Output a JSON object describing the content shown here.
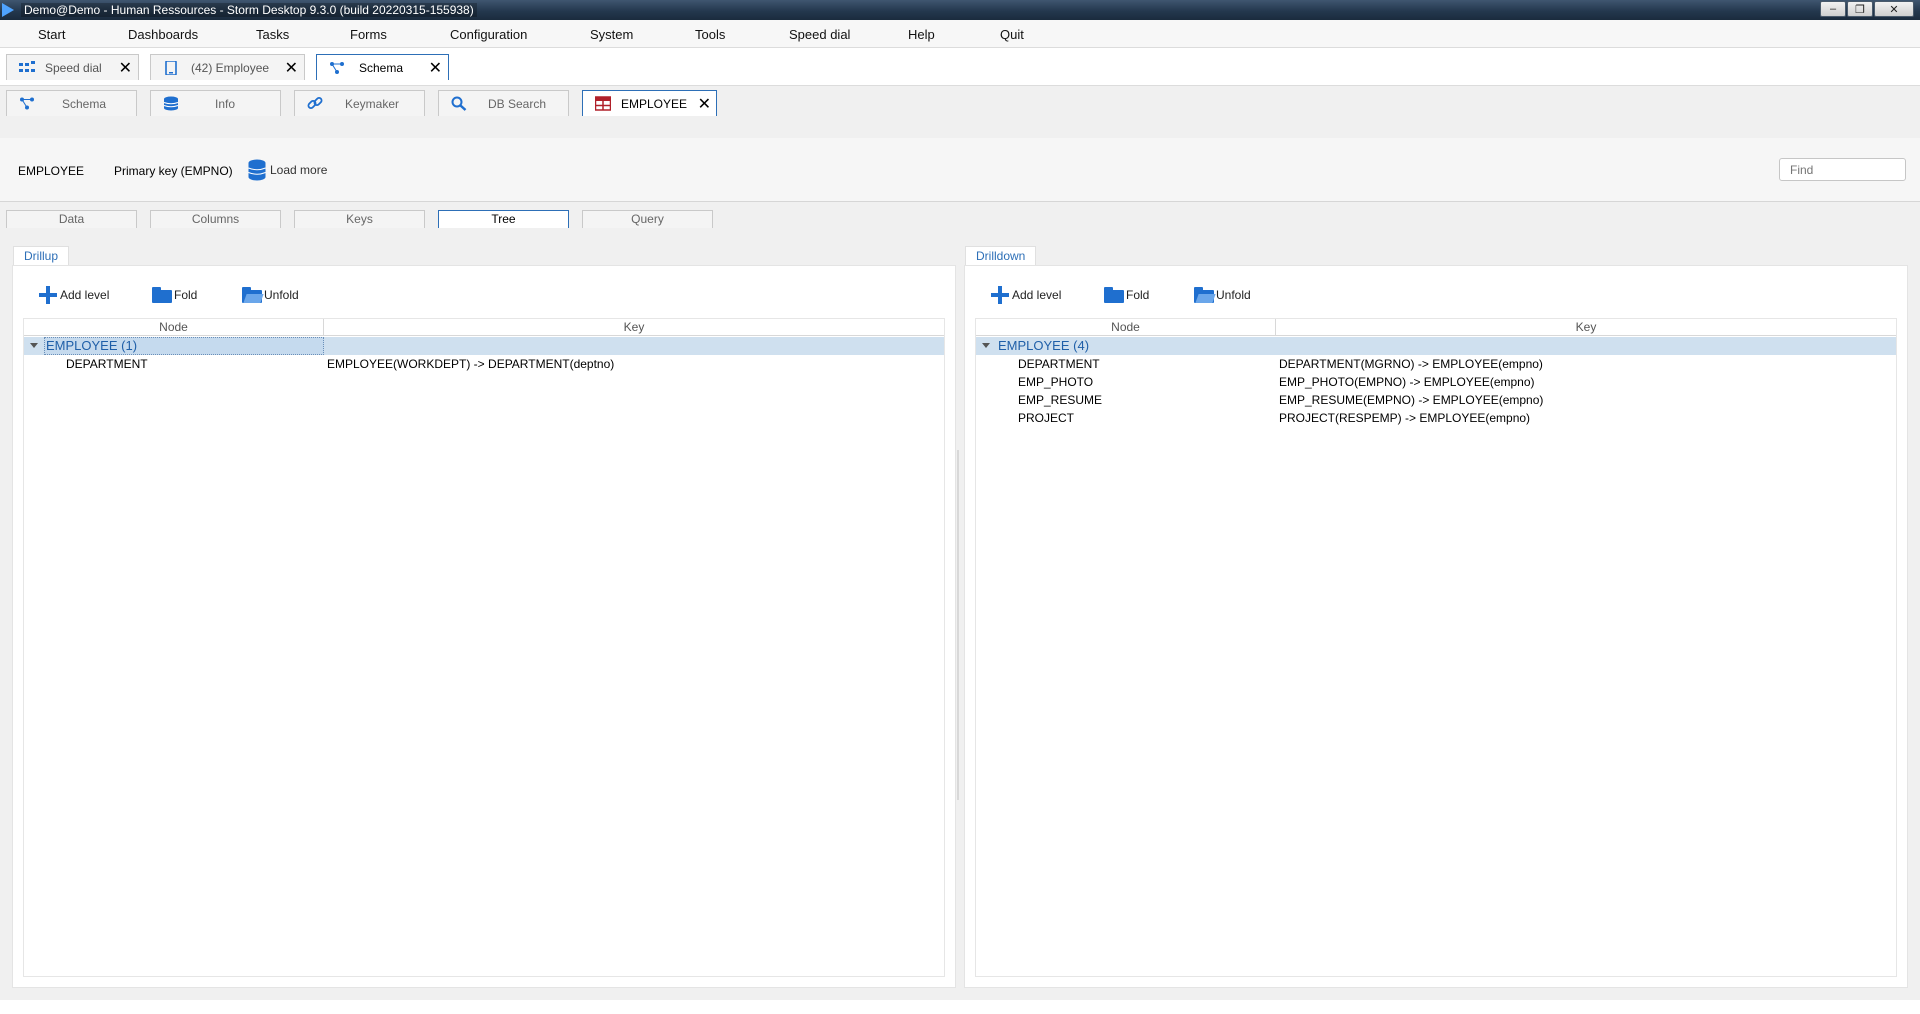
{
  "window": {
    "title": "Demo@Demo - Human Ressources -  Storm Desktop 9.3.0 (build 20220315-155938)"
  },
  "menu": [
    "Start",
    "Dashboards",
    "Tasks",
    "Forms",
    "Configuration",
    "System",
    "Tools",
    "Speed dial",
    "Help",
    "Quit"
  ],
  "doc_tabs": [
    {
      "label": "Speed dial",
      "icon": "grid-icon",
      "active": false
    },
    {
      "label": "(42) Employee",
      "icon": "tablet-icon",
      "active": false
    },
    {
      "label": "Schema",
      "icon": "schema-icon",
      "active": true
    }
  ],
  "schema_tabs": [
    {
      "label": "Schema",
      "icon": "schema-icon",
      "active": false
    },
    {
      "label": "Info",
      "icon": "database-icon",
      "active": false
    },
    {
      "label": "Keymaker",
      "icon": "link-icon",
      "active": false
    },
    {
      "label": "DB Search",
      "icon": "search-icon",
      "active": false
    },
    {
      "label": "EMPLOYEE",
      "icon": "table-icon",
      "active": true
    }
  ],
  "info": {
    "table": "EMPLOYEE",
    "primary_key": "Primary key (EMPNO)",
    "load_more": "Load more",
    "find_placeholder": "Find"
  },
  "sub_tabs": [
    "Data",
    "Columns",
    "Keys",
    "Tree",
    "Query"
  ],
  "active_sub_tab": "Tree",
  "toolbar": {
    "add_level": "Add level",
    "fold": "Fold",
    "unfold": "Unfold"
  },
  "columns": {
    "node": "Node",
    "key": "Key"
  },
  "drillup": {
    "title": "Drillup",
    "root": "EMPLOYEE (1)",
    "rows": [
      {
        "node": "DEPARTMENT",
        "key": "EMPLOYEE(WORKDEPT) -> DEPARTMENT(deptno)"
      }
    ]
  },
  "drilldown": {
    "title": "Drilldown",
    "root": "EMPLOYEE (4)",
    "rows": [
      {
        "node": "DEPARTMENT",
        "key": "DEPARTMENT(MGRNO) -> EMPLOYEE(empno)"
      },
      {
        "node": "EMP_PHOTO",
        "key": "EMP_PHOTO(EMPNO) -> EMPLOYEE(empno)"
      },
      {
        "node": "EMP_RESUME",
        "key": "EMP_RESUME(EMPNO) -> EMPLOYEE(empno)"
      },
      {
        "node": "PROJECT",
        "key": "PROJECT(RESPEMP) -> EMPLOYEE(empno)"
      }
    ]
  },
  "colors": {
    "accent": "#2d6fb7",
    "icon_blue": "#1f6fcf",
    "selection": "#cfe0ef",
    "table_icon": "#b0202a"
  }
}
